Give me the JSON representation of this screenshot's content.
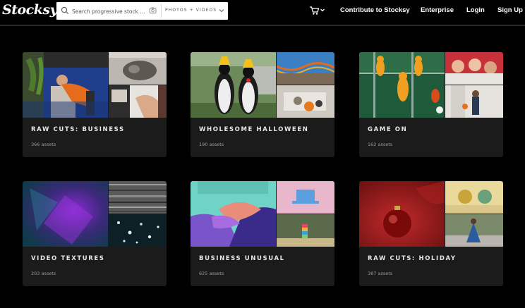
{
  "header": {
    "logo": "Stocksy",
    "search": {
      "placeholder": "Search progressive stock ...",
      "filter_value": "PHOTOS + VIDEOS"
    },
    "nav": {
      "contribute": "Contribute to Stocksy",
      "enterprise": "Enterprise",
      "login": "Login",
      "signup": "Sign Up"
    }
  },
  "collections": [
    {
      "title": "RAW CUTS: BUSINESS",
      "count": "366 assets"
    },
    {
      "title": "WHOLESOME HALLOWEEN",
      "count": "190 assets"
    },
    {
      "title": "GAME ON",
      "count": "162 assets"
    },
    {
      "title": "VIDEO TEXTURES",
      "count": "203 assets"
    },
    {
      "title": "BUSINESS UNUSUAL",
      "count": "625 assets"
    },
    {
      "title": "RAW CUTS: HOLIDAY",
      "count": "387 assets"
    }
  ],
  "icons": {
    "search": "search-icon",
    "camera": "camera-icon",
    "chevron": "chevron-down-icon",
    "cart": "cart-icon"
  },
  "colors": {
    "background": "#000000",
    "card": "#1b1b1b",
    "text": "#ffffff",
    "muted": "#9a9a9a"
  }
}
